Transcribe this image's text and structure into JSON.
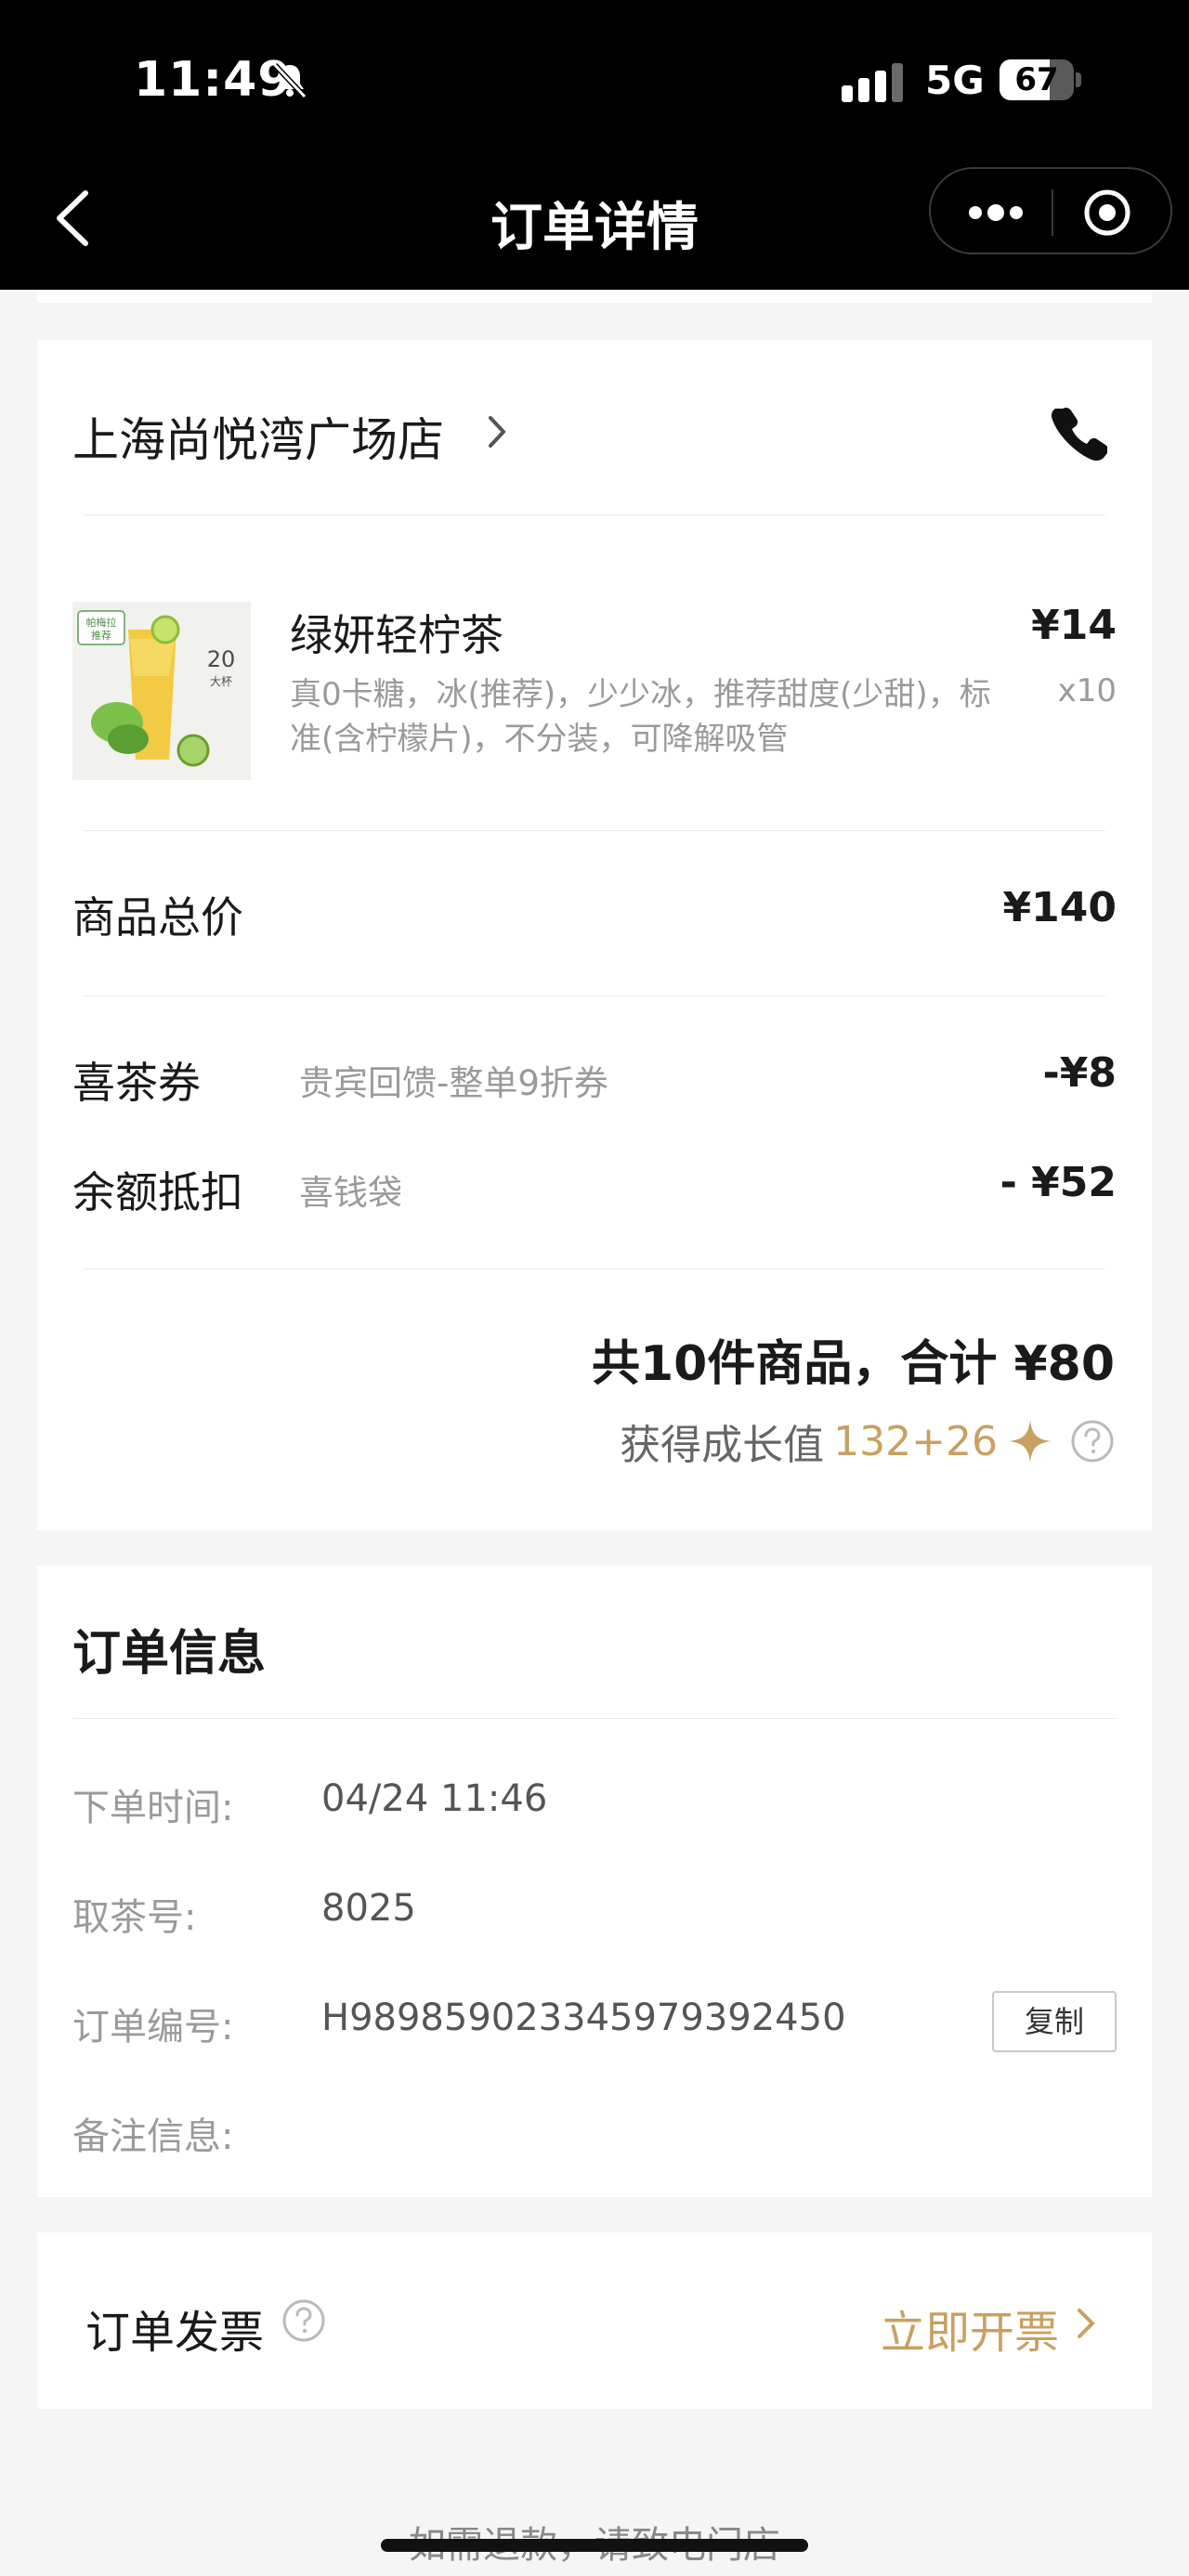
{
  "status_bar": {
    "time": "11:49",
    "network": "5G",
    "battery": "67",
    "battery_fraction": 0.67
  },
  "nav": {
    "title": "订单详情"
  },
  "store": {
    "name": "上海尚悦湾广场店"
  },
  "product": {
    "name": "绿妍轻柠茶",
    "specs": "真0卡糖，冰(推荐)，少少冰，推荐甜度(少甜)，标准(含柠檬片)，不分装，可降解吸管",
    "price": "¥14",
    "quantity": "x10",
    "image": {
      "badge": "帕梅拉推荐",
      "size_text": "20",
      "size_label": "大杯"
    }
  },
  "summary": {
    "goods_total_label": "商品总价",
    "goods_total_value": "¥140",
    "coupon_label": "喜茶券",
    "coupon_desc": "贵宾回馈-整单9折券",
    "coupon_value": "-¥8",
    "balance_label": "余额抵扣",
    "balance_desc": "喜钱袋",
    "balance_value": "- ¥52",
    "total_text": "共10件商品，合计 ¥80",
    "growth_label": "获得成长值",
    "growth_value": "132+26"
  },
  "order_info": {
    "title": "订单信息",
    "time_label": "下单时间:",
    "time_value": "04/24 11:46",
    "pickup_label": "取茶号:",
    "pickup_value": "8025",
    "order_no_label": "订单编号:",
    "order_no_value": "H989859023345979392450",
    "copy_label": "复制",
    "note_label": "备注信息:"
  },
  "invoice": {
    "label": "订单发票",
    "action": "立即开票"
  },
  "footer": {
    "note": "如需退款，请致电门店"
  },
  "colors": {
    "accent": "#c9a062",
    "nav_bg": "#000000",
    "page_bg": "#f5f5f5"
  },
  "icons": [
    "bell-slash-icon",
    "signal-icon",
    "battery-icon",
    "back-arrow-icon",
    "more-dots-icon",
    "target-icon",
    "chevron-right-icon",
    "phone-icon",
    "sparkle-icon",
    "help-circle-icon"
  ]
}
